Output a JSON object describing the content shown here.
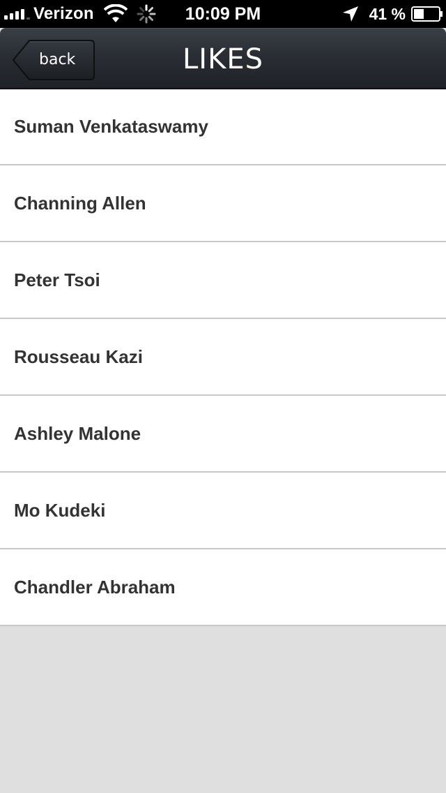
{
  "status_bar": {
    "carrier": "Verizon",
    "time": "10:09 PM",
    "battery_percent": "41 %",
    "signal_bars": 4,
    "battery_level": 0.41,
    "icons": [
      "signal-icon",
      "wifi-icon",
      "spinner-icon",
      "location-icon",
      "battery-icon"
    ]
  },
  "nav": {
    "back_label": "back",
    "title": "LIKES"
  },
  "likes": [
    {
      "name": "Suman Venkataswamy"
    },
    {
      "name": "Channing Allen"
    },
    {
      "name": "Peter Tsoi"
    },
    {
      "name": "Rousseau Kazi"
    },
    {
      "name": "Ashley Malone"
    },
    {
      "name": "Mo Kudeki"
    },
    {
      "name": "Chandler Abraham"
    }
  ],
  "colors": {
    "nav_background": "#2a2e34",
    "list_background": "#ffffff",
    "page_background": "#dfdfdf",
    "name_text": "#333333"
  }
}
